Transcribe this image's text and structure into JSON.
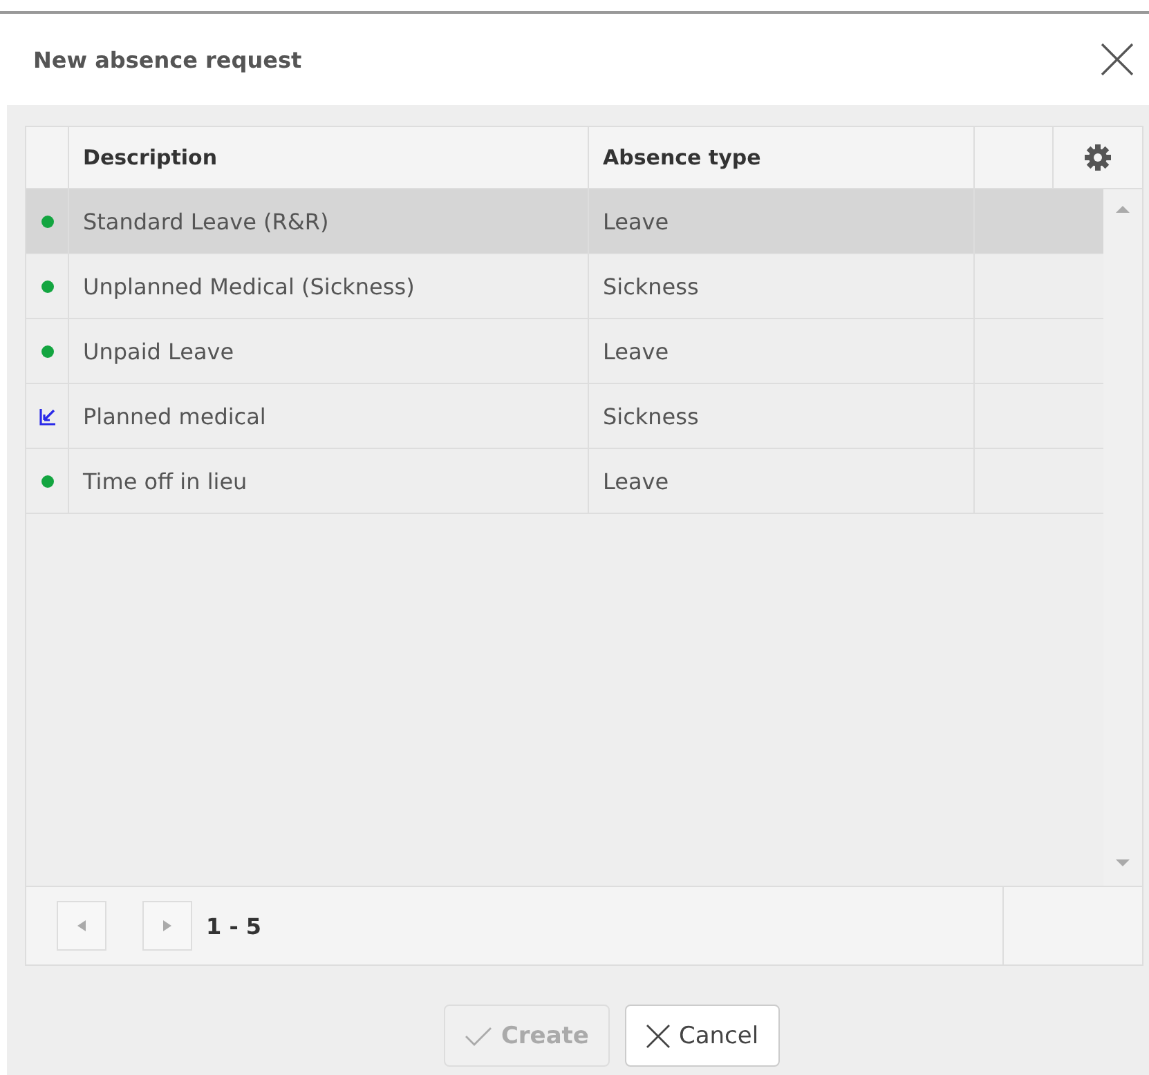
{
  "dialog": {
    "title": "New absence request"
  },
  "table": {
    "columns": [
      "Description",
      "Absence type"
    ],
    "rows": [
      {
        "kind": "dot",
        "description": "Standard Leave (R&R)",
        "absence_type": "Leave",
        "selected": true
      },
      {
        "kind": "dot",
        "description": "Unplanned Medical (Sickness)",
        "absence_type": "Sickness",
        "selected": false
      },
      {
        "kind": "dot",
        "description": "Unpaid Leave",
        "absence_type": "Leave",
        "selected": false
      },
      {
        "kind": "flag",
        "description": "Planned medical",
        "absence_type": "Sickness",
        "selected": false
      },
      {
        "kind": "dot",
        "description": "Time off in lieu",
        "absence_type": "Leave",
        "selected": false
      }
    ]
  },
  "pager": {
    "range": "1 - 5"
  },
  "buttons": [
    {
      "label": "Create",
      "kind": "create",
      "disabled": true
    },
    {
      "label": "Cancel",
      "kind": "cancel",
      "disabled": false
    }
  ]
}
